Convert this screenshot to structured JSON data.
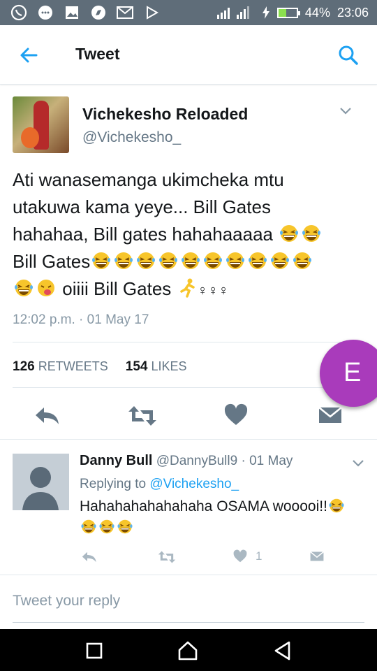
{
  "status": {
    "battery_pct": "44%",
    "time": "23:06",
    "battery_level": 0.44,
    "left_icons": [
      "whatsapp-icon",
      "chat-bubble-icon",
      "gallery-icon",
      "compass-icon",
      "gmail-icon",
      "play-store-icon"
    ]
  },
  "appbar": {
    "title": "Tweet"
  },
  "tweet": {
    "name": "Vichekesho Reloaded",
    "handle": "@Vichekesho_",
    "line1": "Ati wanasemanga ukimcheka mtu",
    "line2": "utakuwa kama yeye... Bill Gates",
    "line3": "hahahaa, Bill gates hahahaaaaa",
    "line4": "Bill Gates",
    "line5_text": "oiiii Bill Gates",
    "line5_tail": "♀♀♀",
    "timestamp": "12:02 p.m. · 01 May 17",
    "retweets_count": "126",
    "retweets_label": "RETWEETS",
    "likes_count": "154",
    "likes_label": "LIKES"
  },
  "fab": {
    "label": "E"
  },
  "reply": {
    "name": "Danny Bull",
    "handle_date": "@DannyBull9 · 01 May",
    "replying_prefix": "Replying to",
    "replying_handle": "@Vichekesho_",
    "text": "Hahahahahahahaha OSAMA wooooi!!",
    "like_count": "1"
  },
  "compose": {
    "placeholder": "Tweet your reply"
  },
  "colors": {
    "accent": "#1da1f2",
    "icon_gray": "#657786",
    "status_bar": "#5f6d79",
    "fab": "#a93bbb"
  }
}
